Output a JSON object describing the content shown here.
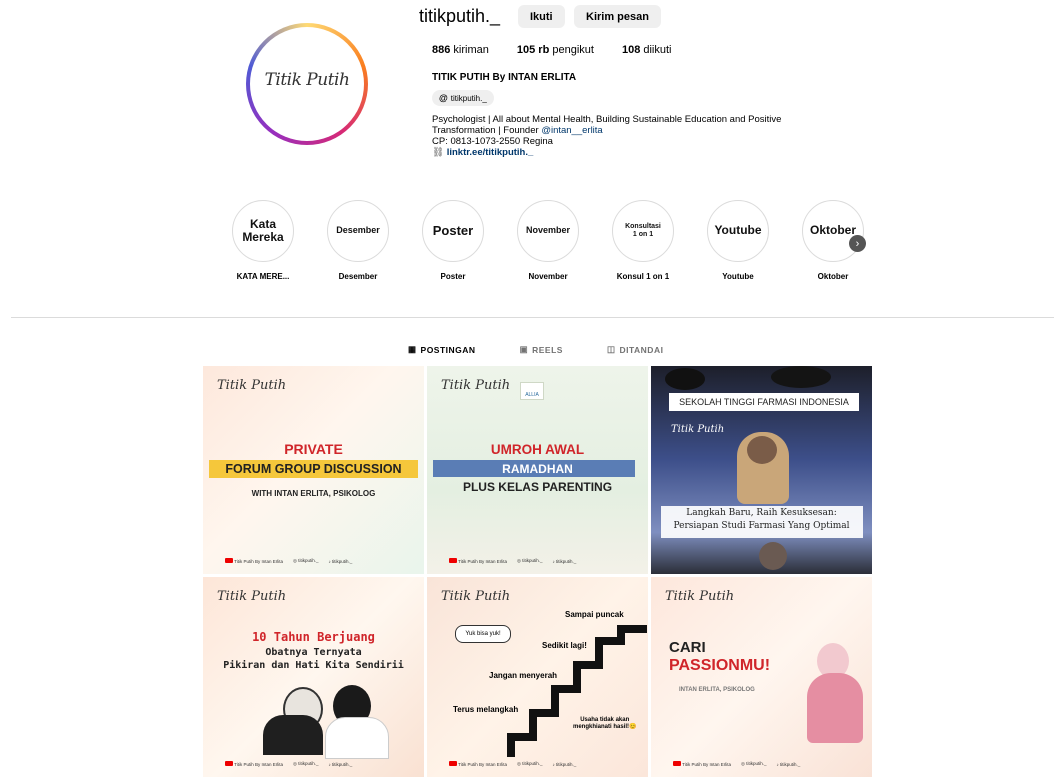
{
  "profile": {
    "username": "titikputih._",
    "avatar_logo": "Titik Putih",
    "follow_label": "Ikuti",
    "message_label": "Kirim pesan",
    "posts_count": "886",
    "posts_label": "kiriman",
    "followers_count": "105 rb",
    "followers_label": "pengikut",
    "following_count": "108",
    "following_label": "diikuti",
    "full_name": "TITIK PUTIH By INTAN ERLITA",
    "threads_handle": "titikputih._",
    "bio_line1": "Psychologist | All about Mental Health, Building Sustainable Education and Positive",
    "bio_line2a": "Transformation | Founder ",
    "bio_mention": "@intan__erlita",
    "bio_line3": "CP: 0813-1073-2550 Regina",
    "link": "linktr.ee/titikputih._"
  },
  "highlights": [
    {
      "cover": "Kata Mereka",
      "label": "KATA MERE..."
    },
    {
      "cover": "Desember",
      "label": "Desember"
    },
    {
      "cover": "Poster",
      "label": "Poster"
    },
    {
      "cover": "November",
      "label": "November"
    },
    {
      "cover": "Konsultasi 1 on 1",
      "label": "Konsul 1 on 1"
    },
    {
      "cover": "Youtube",
      "label": "Youtube"
    },
    {
      "cover": "Oktober",
      "label": "Oktober"
    }
  ],
  "tabs": [
    {
      "label": "POSTINGAN",
      "active": true
    },
    {
      "label": "REELS",
      "active": false
    },
    {
      "label": "DITANDAI",
      "active": false
    }
  ],
  "posts": [
    {
      "brand": "Titik Putih",
      "line1": "PRIVATE",
      "line2": "FORUM GROUP DISCUSSION",
      "line3": "WITH INTAN ERLITA, PSIKOLOG"
    },
    {
      "brand": "Titik Putih",
      "badge": "ALLIA",
      "line1": "UMROH AWAL",
      "line2": "RAMADHAN",
      "line3": "PLUS KELAS PARENTING"
    },
    {
      "banner": "SEKOLAH TINGGI FARMASI INDONESIA",
      "brand": "Titik Putih",
      "caption1": "Langkah Baru, Raih Kesuksesan:",
      "caption2": "Persiapan Studi Farmasi Yang Optimal"
    },
    {
      "brand": "Titik Putih",
      "line1": "10 Tahun Berjuang",
      "line2": "Obatnya Ternyata",
      "line3": "Pikiran dan Hati Kita Sendirii"
    },
    {
      "brand": "Titik Putih",
      "bubble": "Yuk bisa yuk!",
      "s1": "Sampai puncak",
      "s2": "Sedikit lagi!",
      "s3": "Jangan menyerah",
      "s4": "Terus melangkah",
      "s5a": "Usaha tidak akan",
      "s5b": "mengkhianati hasil!😊"
    },
    {
      "brand": "Titik Putih",
      "line1": "CARI",
      "line2": "PASSIONMU!",
      "line3": "INTAN ERLITA, PSIKOLOG"
    }
  ],
  "footer": {
    "channel": "Titik Putih By Intan Erlita",
    "ig": "titikputih._",
    "tt": "titikputih._"
  },
  "colors": {
    "red": "#d0252a",
    "blue_band": "#5a7db5",
    "link": "#00376b"
  }
}
